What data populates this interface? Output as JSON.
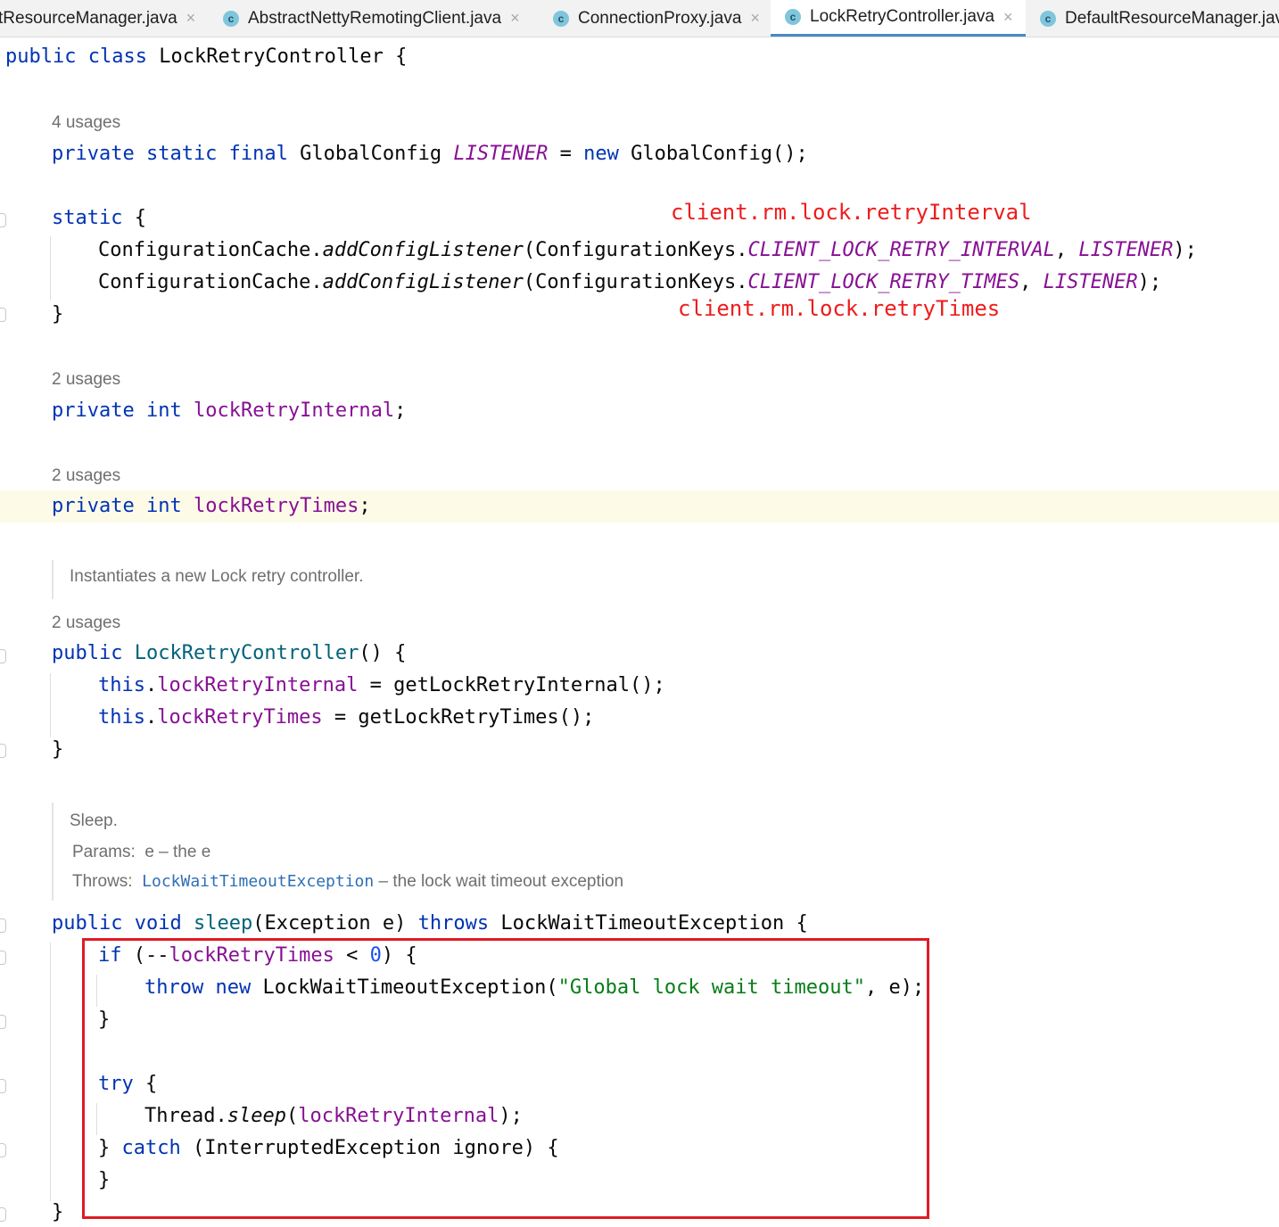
{
  "tabs": [
    {
      "label": "tResourceManager.java",
      "icon": "",
      "close": "×"
    },
    {
      "label": "AbstractNettyRemotingClient.java",
      "icon": "c",
      "close": "×"
    },
    {
      "label": "ConnectionProxy.java",
      "icon": "c",
      "close": "×"
    },
    {
      "label": "LockRetryController.java",
      "icon": "c",
      "close": "×"
    },
    {
      "label": "DefaultResourceManager.jav",
      "icon": "c",
      "close": ""
    }
  ],
  "code": {
    "class_public": "public",
    "class_kw": "class",
    "class_name": "LockRetryController",
    "brace_open": "{",
    "brace_close": "}",
    "usages_listener": "4 usages",
    "listener_mod": "private static final",
    "listener_type": "GlobalConfig",
    "listener_name": "LISTENER",
    "listener_eq": "=",
    "listener_new": "new",
    "listener_init": "GlobalConfig();",
    "static_kw": "static",
    "cache_class": "ConfigurationCache.",
    "add_method": "addConfigListener",
    "keys_class": "(ConfigurationKeys.",
    "key_interval": "CLIENT_LOCK_RETRY_INTERVAL",
    "key_times": "CLIENT_LOCK_RETRY_TIMES",
    "comma": ", ",
    "args_end": ");",
    "usages_internal": "2 usages",
    "private_kw": "private",
    "int_kw": "int",
    "field_internal": "lockRetryInternal",
    "field_times": "lockRetryTimes",
    "semicolon": ";",
    "usages_times": "2 usages",
    "doc_ctor": "Instantiates a new Lock retry controller.",
    "usages_ctor": "2 usages",
    "ctor_public": "public",
    "ctor_name": "LockRetryController",
    "ctor_paren": "() {",
    "this_kw": "this",
    "dot": ".",
    "assign_internal": " = getLockRetryInternal();",
    "assign_times": " = getLockRetryTimes();",
    "doc_sleep": "Sleep.",
    "doc_params_label": "Params:",
    "doc_params_text": "e – the e",
    "doc_throws_label": "Throws:",
    "doc_throws_link": "LockWaitTimeoutException",
    "doc_throws_text": "– the lock wait timeout exception",
    "sleep_public": "public",
    "sleep_void": "void",
    "sleep_name": "sleep",
    "sleep_params": "(Exception e)",
    "throws_kw": "throws",
    "sleep_exc": "LockWaitTimeoutException {",
    "if_kw": "if",
    "if_open": " (--",
    "if_cmp": " < ",
    "zero": "0",
    "if_close": ") {",
    "throw_kw": "throw",
    "new_kw": "new",
    "exc_ctor": "LockWaitTimeoutException(",
    "exc_msg": "\"Global lock wait timeout\"",
    "exc_end": ", e);",
    "try_kw": "try",
    "thread_class": "Thread.",
    "thread_sleep": "sleep",
    "paren_open": "(",
    "call_end": ");",
    "catch_close": "} ",
    "catch_kw": "catch",
    "catch_params": " (InterruptedException ignore) {"
  },
  "annotations": {
    "interval_key": "client.rm.lock.retryInterval",
    "times_key": "client.rm.lock.retryTimes",
    "color": "#ee1c1c"
  },
  "colors": {
    "keyword": "#0033b3",
    "field": "#871094",
    "string": "#067d17",
    "number": "#1750eb",
    "declaration": "#00627a",
    "highlight_line": "#fdfbe8",
    "red_box": "#e11b23"
  }
}
